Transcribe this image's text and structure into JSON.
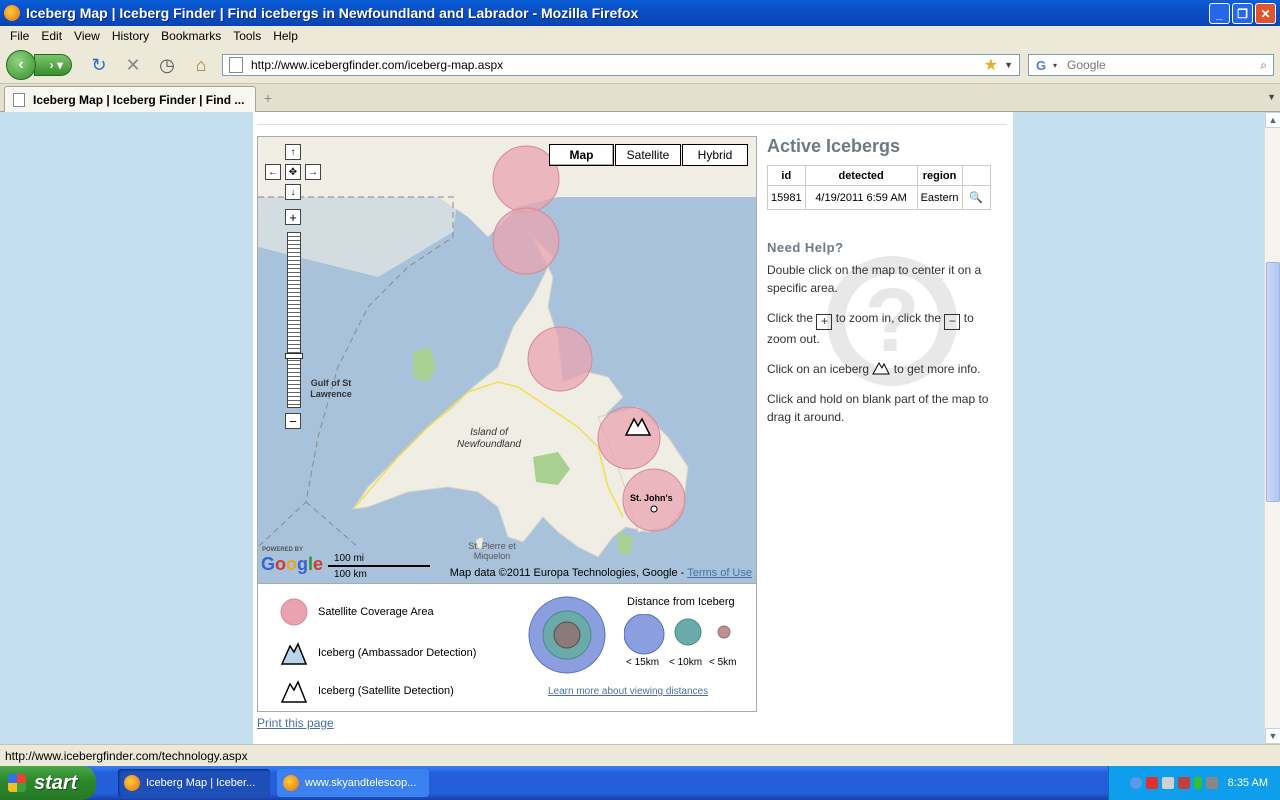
{
  "window": {
    "title": "Iceberg Map | Iceberg Finder | Find icebergs in Newfoundland and Labrador - Mozilla Firefox"
  },
  "menu": [
    "File",
    "Edit",
    "View",
    "History",
    "Bookmarks",
    "Tools",
    "Help"
  ],
  "toolbar": {
    "url": "http://www.icebergfinder.com/iceberg-map.aspx",
    "search_placeholder": "Google"
  },
  "tabs": [
    {
      "label": "Iceberg Map | Iceberg Finder | Find ..."
    }
  ],
  "map": {
    "types": [
      "Map",
      "Satellite",
      "Hybrid"
    ],
    "active_type": "Map",
    "labels": {
      "gulf": "Gulf of St Lawrence",
      "island": "Island of Newfoundland",
      "stjohns": "St. John's",
      "stpierre": "St. Pierre et Miquelon"
    },
    "scale": {
      "mi": "100 mi",
      "km": "100 km"
    },
    "attribution": "Map data ©2011 Europa Technologies, Google - ",
    "terms": "Terms of Use",
    "powered_by": "POWERED BY",
    "google": "Google"
  },
  "legend": {
    "coverage": "Satellite Coverage Area",
    "ambassador": "Iceberg (Ambassador Detection)",
    "satellite": "Iceberg (Satellite Detection)",
    "distance_title": "Distance from Iceberg",
    "d15": "< 15km",
    "d10": "< 10km",
    "d5": "< 5km",
    "learn_more": "Learn more about viewing distances"
  },
  "print_link": "Print this page",
  "active": {
    "heading": "Active Icebergs",
    "columns": [
      "id",
      "detected",
      "region"
    ],
    "rows": [
      {
        "id": "15981",
        "detected": "4/19/2011 6:59 AM",
        "region": "Eastern"
      }
    ]
  },
  "help": {
    "heading": "Need Help?",
    "p1": "Double click on the map to center it on a specific area.",
    "p2a": "Click the",
    "p2b": "to zoom in, click the",
    "p2c": "to zoom out.",
    "p3a": "Click on an iceberg",
    "p3b": "to get more info.",
    "p4": "Click and hold on blank part of the map to drag it around."
  },
  "status": {
    "text": "http://www.icebergfinder.com/technology.aspx"
  },
  "taskbar": {
    "start": "start",
    "items": [
      "Iceberg Map | Iceber...",
      "www.skyandtelescop..."
    ],
    "clock": "8:35 AM"
  },
  "colors": {
    "page_bg": "#c6dff0",
    "coverage": "#e9a3b0",
    "water": "#a9c2dc",
    "land": "#f0ede5"
  }
}
